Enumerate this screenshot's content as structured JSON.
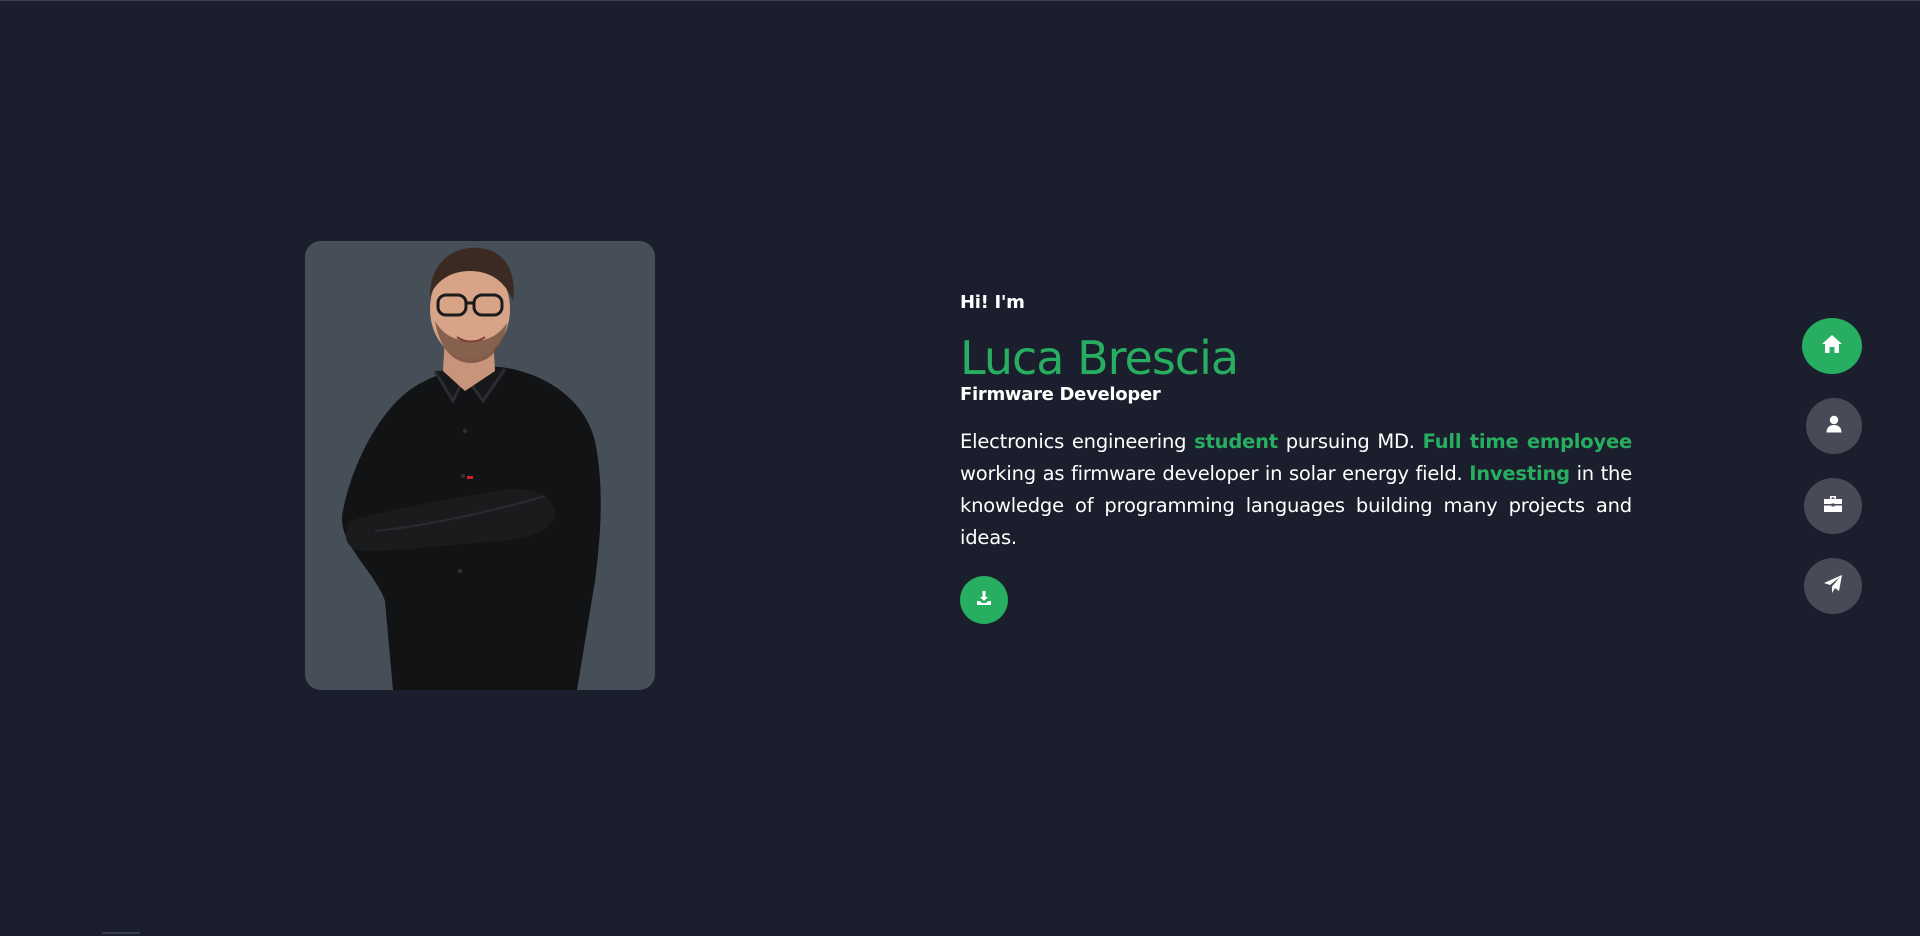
{
  "colors": {
    "background": "#1b1e2c",
    "accent": "#27ae60",
    "card": "#464e57",
    "nav_inactive": "#464b55",
    "text": "#ffffff"
  },
  "intro": {
    "greeting": "Hi! I'm",
    "name": "Luca Brescia",
    "role": "Firmware Developer",
    "bio": {
      "part1": "Electronics engineering ",
      "accent1": "student",
      "part2": " pursuing MD. ",
      "accent2": "Full time employee",
      "part3": " working as firmware developer in solar energy field. ",
      "accent3": "Investing",
      "part4": " in the knowledge of programming languages building many projects and ideas."
    },
    "download_icon": "download-icon"
  },
  "sidenav": {
    "items": [
      {
        "icon": "home-icon",
        "active": true
      },
      {
        "icon": "user-icon",
        "active": false
      },
      {
        "icon": "briefcase-icon",
        "active": false
      },
      {
        "icon": "paper-plane-icon",
        "active": false
      }
    ]
  }
}
